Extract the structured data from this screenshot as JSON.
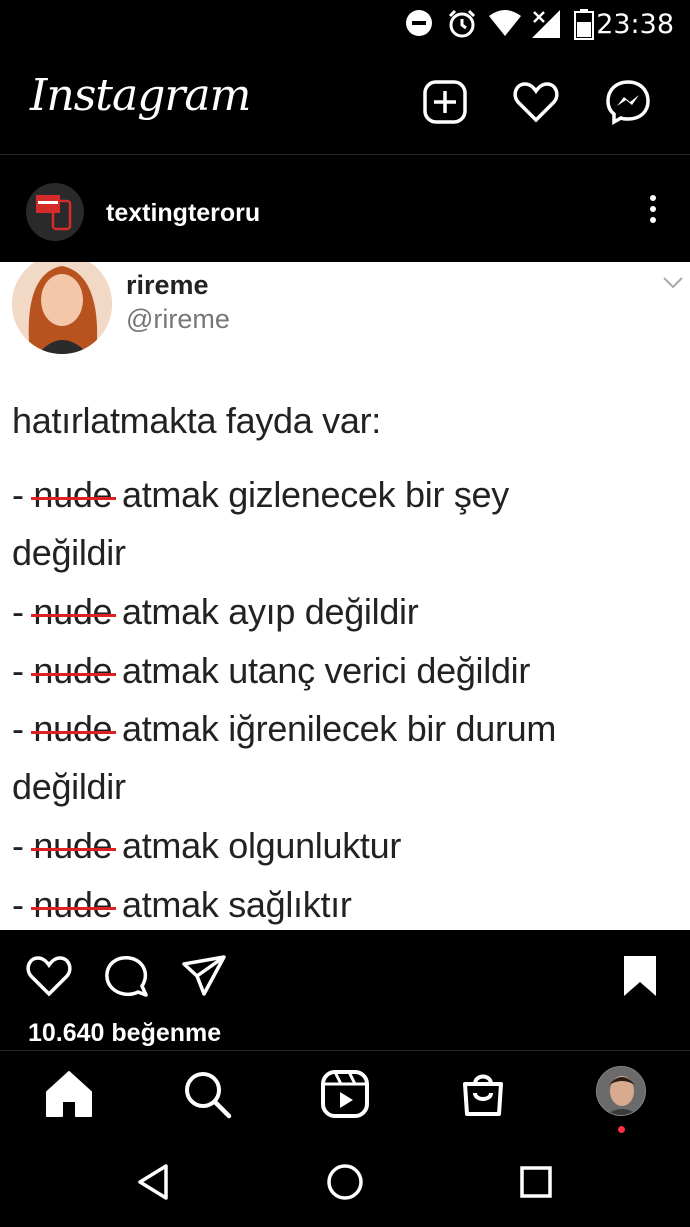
{
  "status_bar": {
    "time": "23:38",
    "icons": [
      "do-not-disturb-icon",
      "alarm-icon",
      "wifi-icon",
      "signal-icon",
      "battery-icon"
    ]
  },
  "app_header": {
    "logo": "Instagram",
    "icons": [
      "new-post-icon",
      "heart-icon",
      "messenger-icon"
    ]
  },
  "post": {
    "author": "textingteroru",
    "tweet": {
      "name": "rireme",
      "handle": "@rireme",
      "intro": "hatırlatmakta fayda var:",
      "lines": [
        {
          "dash": "- ",
          "struck": "nude",
          "rest": " atmak gizlenecek bir şey"
        },
        {
          "dash": "",
          "struck": "",
          "rest": "değildir"
        },
        {
          "dash": "- ",
          "struck": "nude",
          "rest": " atmak ayıp değildir"
        },
        {
          "dash": "- ",
          "struck": "nude",
          "rest": " atmak utanç verici değildir"
        },
        {
          "dash": "- ",
          "struck": "nude",
          "rest": " atmak iğrenilecek bir durum"
        },
        {
          "dash": "",
          "struck": "",
          "rest": "değildir"
        },
        {
          "dash": "- ",
          "struck": "nude",
          "rest": " atmak olgunluktur"
        },
        {
          "dash": "- ",
          "struck": "nude",
          "rest": " atmak sağlıktır"
        }
      ]
    },
    "likes": "10.640 beğenme"
  },
  "actions": [
    "like-icon",
    "comment-icon",
    "share-icon",
    "save-icon"
  ],
  "bottom_nav": [
    "home-icon",
    "search-icon",
    "reels-icon",
    "shop-icon",
    "profile-avatar"
  ],
  "system_nav": [
    "back-icon",
    "home-circle-icon",
    "recents-icon"
  ],
  "colors": {
    "background": "#000000",
    "strike": "#dd2222",
    "notification_dot": "#ff3040"
  }
}
